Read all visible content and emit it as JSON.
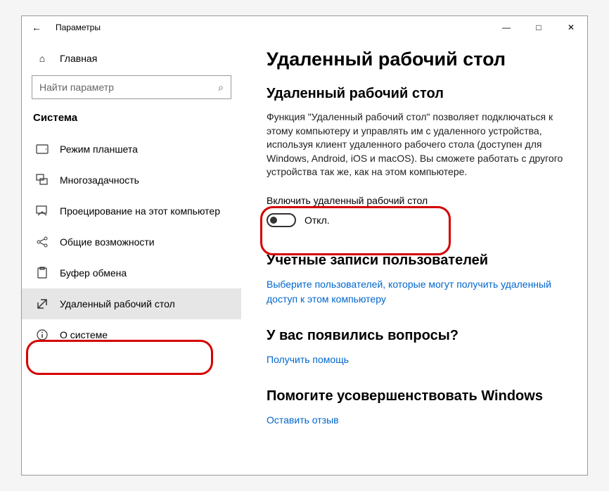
{
  "titlebar": {
    "title": "Параметры"
  },
  "sidebar": {
    "home_label": "Главная",
    "search_placeholder": "Найти параметр",
    "section_title": "Система",
    "items": [
      {
        "label": "Режим планшета"
      },
      {
        "label": "Многозадачность"
      },
      {
        "label": "Проецирование на этот компьютер"
      },
      {
        "label": "Общие возможности"
      },
      {
        "label": "Буфер обмена"
      },
      {
        "label": "Удаленный рабочий стол"
      },
      {
        "label": "О системе"
      }
    ]
  },
  "main": {
    "page_title": "Удаленный рабочий стол",
    "section1_title": "Удаленный рабочий стол",
    "description": "Функция \"Удаленный рабочий стол\" позволяет подключаться к этому компьютеру и управлять им с удаленного устройства, используя клиент удаленного рабочего стола (доступен для Windows, Android, iOS и macOS). Вы сможете работать с другого устройства так же, как на этом компьютере.",
    "toggle_label": "Включить удаленный рабочий стол",
    "toggle_state": "Откл.",
    "section2_title": "Учетные записи пользователей",
    "users_link": "Выберите пользователей, которые могут получить удаленный доступ к этом компьютеру",
    "section3_title": "У вас появились вопросы?",
    "help_link": "Получить помощь",
    "section4_title": "Помогите усовершенствовать Windows",
    "feedback_link": "Оставить отзыв"
  }
}
